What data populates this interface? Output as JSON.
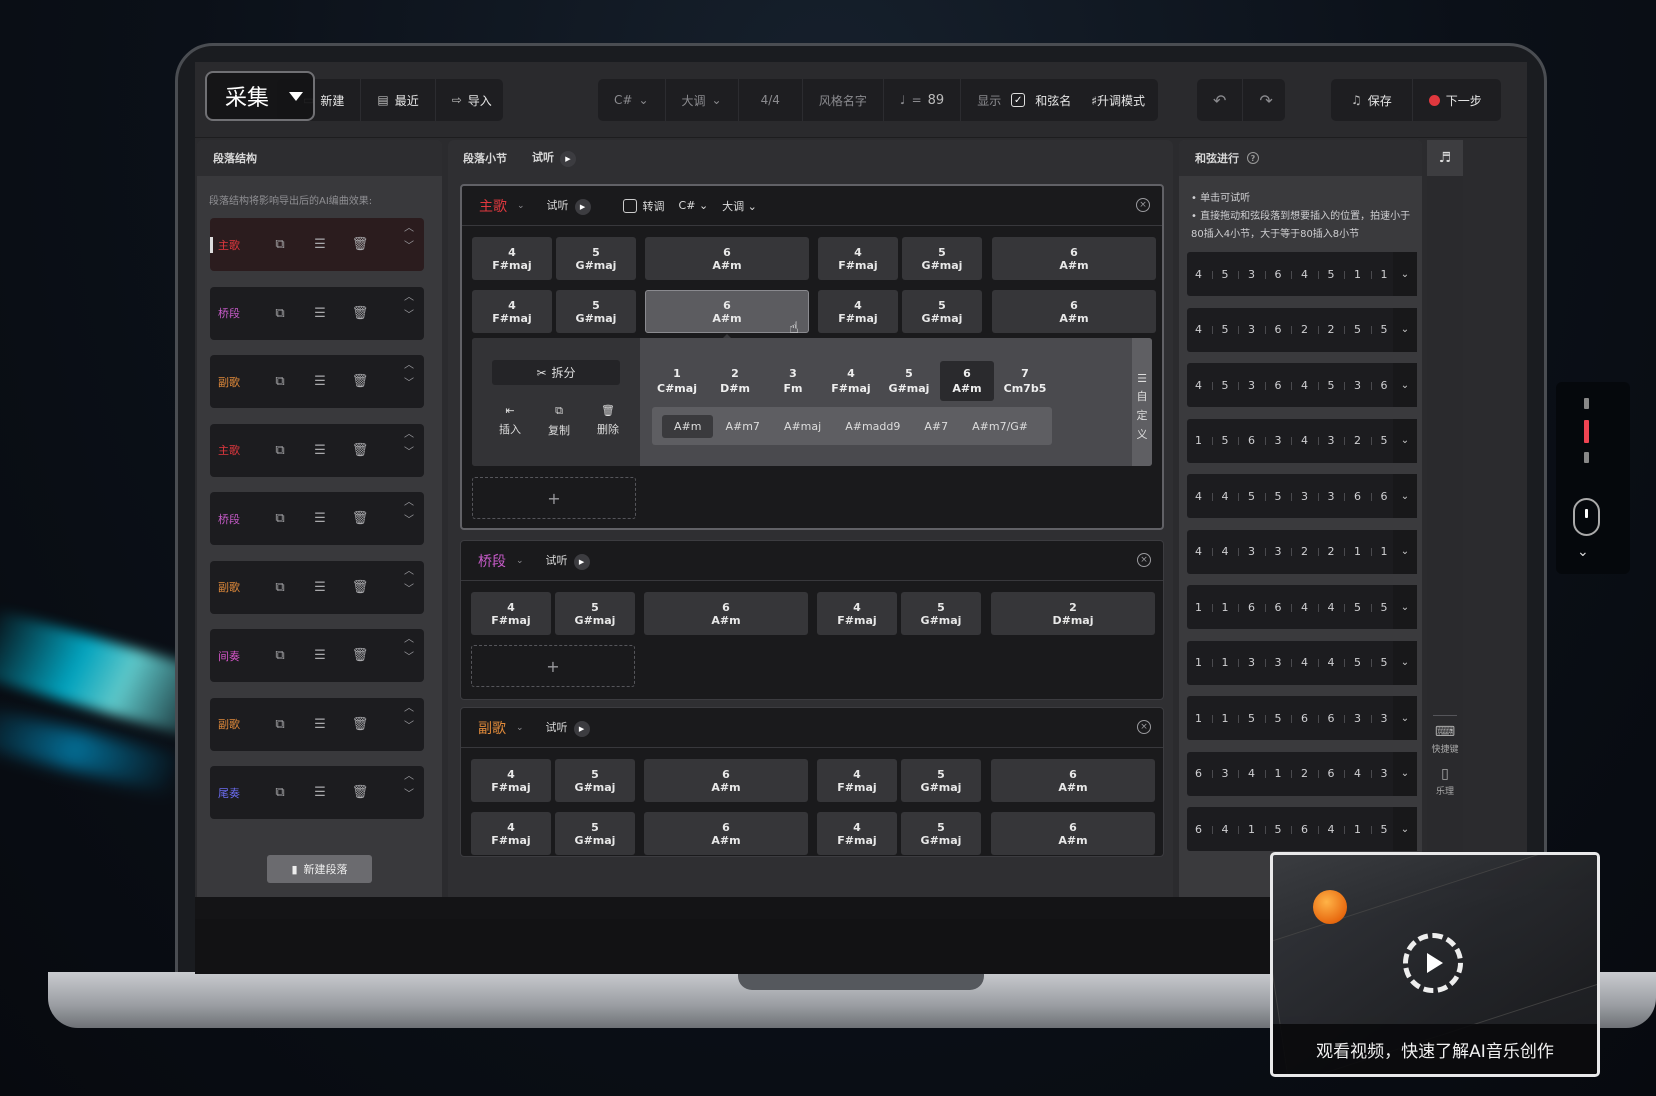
{
  "topbar": {
    "logo_overlay": "采集",
    "new_label": "新建",
    "recent_label": "最近",
    "import_label": "导入",
    "key": "C#",
    "mode": "大调",
    "time_signature": "4/4",
    "style_name": "风格名字",
    "tempo_prefix": "=",
    "tempo": "89",
    "display_label": "显示",
    "chord_name_label": "和弦名",
    "chord_name_checked": true,
    "sharp_mode_label": "♯升调模式",
    "save_label": "保存",
    "next_label": "下一步"
  },
  "left_panel": {
    "title": "段落结构",
    "note": "段落结构将影响导出后的AI编曲效果:",
    "sections": [
      {
        "name": "主歌",
        "color": "#e0383e",
        "active": true
      },
      {
        "name": "桥段",
        "color": "#c75bc9"
      },
      {
        "name": "副歌",
        "color": "#e08a3a"
      },
      {
        "name": "主歌",
        "color": "#e0383e"
      },
      {
        "name": "桥段",
        "color": "#c75bc9"
      },
      {
        "name": "副歌",
        "color": "#e08a3a"
      },
      {
        "name": "间奏",
        "color": "#d455c8"
      },
      {
        "name": "副歌",
        "color": "#e08a3a"
      },
      {
        "name": "尾奏",
        "color": "#6b6cf0"
      }
    ],
    "new_section_label": "新建段落"
  },
  "mid_panel": {
    "title": "段落小节",
    "preview_label": "试听",
    "cards": [
      {
        "title": "主歌",
        "color": "#e0383e",
        "preview": "试听",
        "modulate_label": "转调",
        "key": "C#",
        "mode": "大调",
        "rows": [
          [
            {
              "d": "4",
              "c": "F#maj"
            },
            {
              "d": "5",
              "c": "G#maj"
            },
            {
              "d": "6",
              "c": "A#m"
            },
            {
              "d": "4",
              "c": "F#maj"
            },
            {
              "d": "5",
              "c": "G#maj"
            },
            {
              "d": "6",
              "c": "A#m"
            }
          ],
          [
            {
              "d": "4",
              "c": "F#maj"
            },
            {
              "d": "5",
              "c": "G#maj"
            },
            {
              "d": "6",
              "c": "A#m",
              "selected": true
            },
            {
              "d": "4",
              "c": "F#maj"
            },
            {
              "d": "5",
              "c": "G#maj"
            },
            {
              "d": "6",
              "c": "A#m"
            }
          ]
        ]
      },
      {
        "title": "桥段",
        "color": "#c75bc9",
        "preview": "试听",
        "rows": [
          [
            {
              "d": "4",
              "c": "F#maj"
            },
            {
              "d": "5",
              "c": "G#maj"
            },
            {
              "d": "6",
              "c": "A#m"
            },
            {
              "d": "4",
              "c": "F#maj"
            },
            {
              "d": "5",
              "c": "G#maj"
            },
            {
              "d": "2",
              "c": "D#maj"
            }
          ]
        ]
      },
      {
        "title": "副歌",
        "color": "#e08a3a",
        "preview": "试听",
        "rows": [
          [
            {
              "d": "4",
              "c": "F#maj"
            },
            {
              "d": "5",
              "c": "G#maj"
            },
            {
              "d": "6",
              "c": "A#m"
            },
            {
              "d": "4",
              "c": "F#maj"
            },
            {
              "d": "5",
              "c": "G#maj"
            },
            {
              "d": "6",
              "c": "A#m"
            }
          ],
          [
            {
              "d": "4",
              "c": "F#maj"
            },
            {
              "d": "5",
              "c": "G#maj"
            },
            {
              "d": "6",
              "c": "A#m"
            },
            {
              "d": "4",
              "c": "F#maj"
            },
            {
              "d": "5",
              "c": "G#maj"
            },
            {
              "d": "6",
              "c": "A#m"
            }
          ]
        ]
      }
    ],
    "add_label": "+",
    "popup": {
      "split_label": "拆分",
      "insert_label": "插入",
      "copy_label": "复制",
      "delete_label": "删除",
      "degrees": [
        {
          "d": "1",
          "c": "C#maj"
        },
        {
          "d": "2",
          "c": "D#m"
        },
        {
          "d": "3",
          "c": "Fm"
        },
        {
          "d": "4",
          "c": "F#maj"
        },
        {
          "d": "5",
          "c": "G#maj"
        },
        {
          "d": "6",
          "c": "A#m",
          "selected": true
        },
        {
          "d": "7",
          "c": "Cm7b5"
        }
      ],
      "variants": [
        "A#m",
        "A#m7",
        "A#maj",
        "A#madd9",
        "A#7",
        "A#m7/G#"
      ],
      "selected_variant": "A#m",
      "custom_label": [
        "自",
        "定",
        "义"
      ]
    }
  },
  "right_panel": {
    "title": "和弦进行",
    "tip1": "单击可试听",
    "tip2": "直接拖动和弦段落到想要插入的位置，拍速小于80插入4小节，大于等于80插入8小节",
    "progressions": [
      [
        "4",
        "5",
        "3",
        "6",
        "4",
        "5",
        "1",
        "1"
      ],
      [
        "4",
        "5",
        "3",
        "6",
        "2",
        "2",
        "5",
        "5"
      ],
      [
        "4",
        "5",
        "3",
        "6",
        "4",
        "5",
        "3",
        "6"
      ],
      [
        "1",
        "5",
        "6",
        "3",
        "4",
        "3",
        "2",
        "5"
      ],
      [
        "4",
        "4",
        "5",
        "5",
        "3",
        "3",
        "6",
        "6"
      ],
      [
        "4",
        "4",
        "3",
        "3",
        "2",
        "2",
        "1",
        "1"
      ],
      [
        "1",
        "1",
        "6",
        "6",
        "4",
        "4",
        "5",
        "5"
      ],
      [
        "1",
        "1",
        "3",
        "3",
        "4",
        "4",
        "5",
        "5"
      ],
      [
        "1",
        "1",
        "5",
        "5",
        "6",
        "6",
        "3",
        "3"
      ],
      [
        "6",
        "3",
        "4",
        "1",
        "2",
        "6",
        "4",
        "3"
      ],
      [
        "6",
        "4",
        "1",
        "5",
        "6",
        "4",
        "1",
        "5"
      ]
    ]
  },
  "side_tools": {
    "shortcut_label": "快捷键",
    "theory_label": "乐理"
  },
  "video_promo": {
    "caption": "观看视频，快速了解AI音乐创作"
  }
}
